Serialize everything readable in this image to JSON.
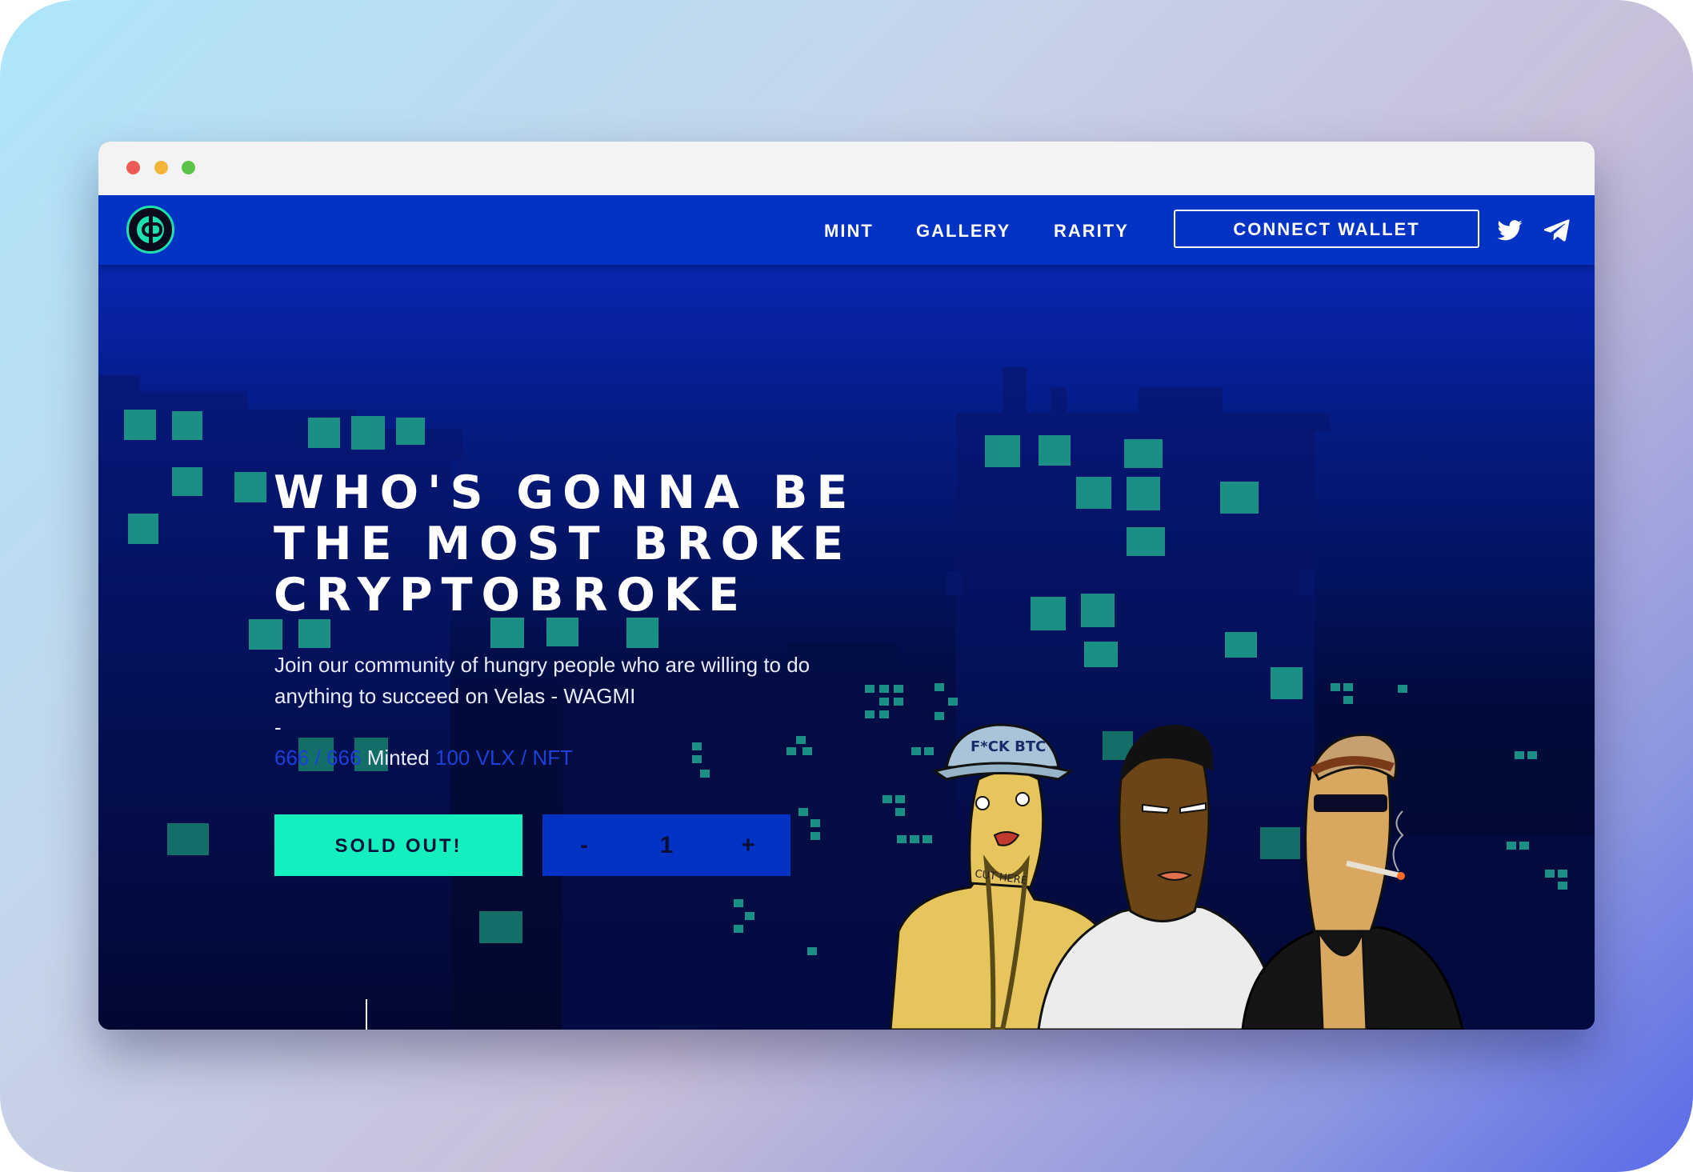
{
  "nav": {
    "links": [
      "MINT",
      "GALLERY",
      "RARITY"
    ],
    "connect_wallet": "CONNECT WALLET",
    "icons": [
      "twitter-icon",
      "telegram-icon"
    ]
  },
  "hero": {
    "title_lines": [
      "WHO'S GONNA BE",
      "THE MOST BROKE",
      "CRYPTOBROKE"
    ],
    "description": "Join our community of hungry people who are willing to do anything to succeed on Velas - WAGMI",
    "dash": "-",
    "minted_count": "666",
    "minted_sep": "/",
    "minted_total": "666",
    "minted_label": "Minted",
    "price": "100 VLX",
    "price_sep": "/",
    "price_unit": "NFT"
  },
  "mint": {
    "sold_out_label": "SOLD OUT!",
    "minus": "-",
    "quantity": "1",
    "plus": "+"
  },
  "art": {
    "hat_text": "F*CK BTC",
    "neck_text": "CUT HERE"
  },
  "colors": {
    "accent": "#14f0bd",
    "nav": "#0333c4",
    "window_green": "#1a8f86"
  }
}
